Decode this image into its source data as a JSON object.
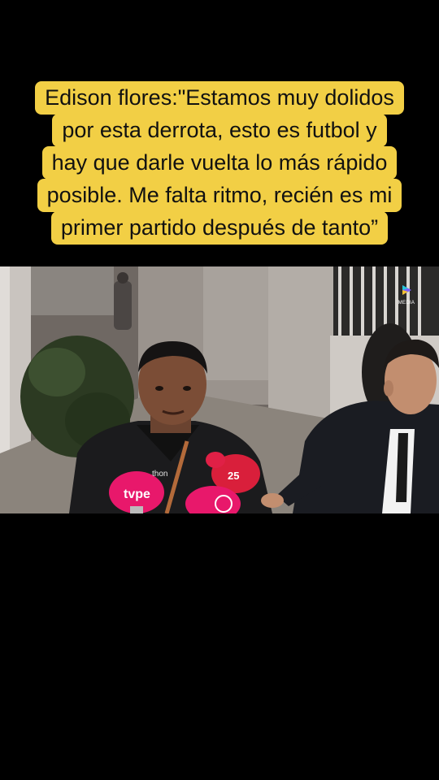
{
  "caption": {
    "lines": [
      "Edison flores:\"Estamos muy dolidos",
      "por esta derrota, esto es futbol y",
      "hay que darle vuelta lo más rápido",
      "posible. Me falta ritmo, recién es mi",
      "primer partido después de tanto”"
    ]
  },
  "video": {
    "mic_labels": {
      "tvpe": "tvpe",
      "latina": "25",
      "jersey_brand": "thon"
    },
    "watermark": {
      "icon": "play-logo-icon",
      "label": "MEDIA"
    }
  },
  "colors": {
    "caption_bg": "#f2cf45",
    "background": "#000000",
    "mic_pink": "#e8186b",
    "mic_red": "#d91f3b"
  }
}
